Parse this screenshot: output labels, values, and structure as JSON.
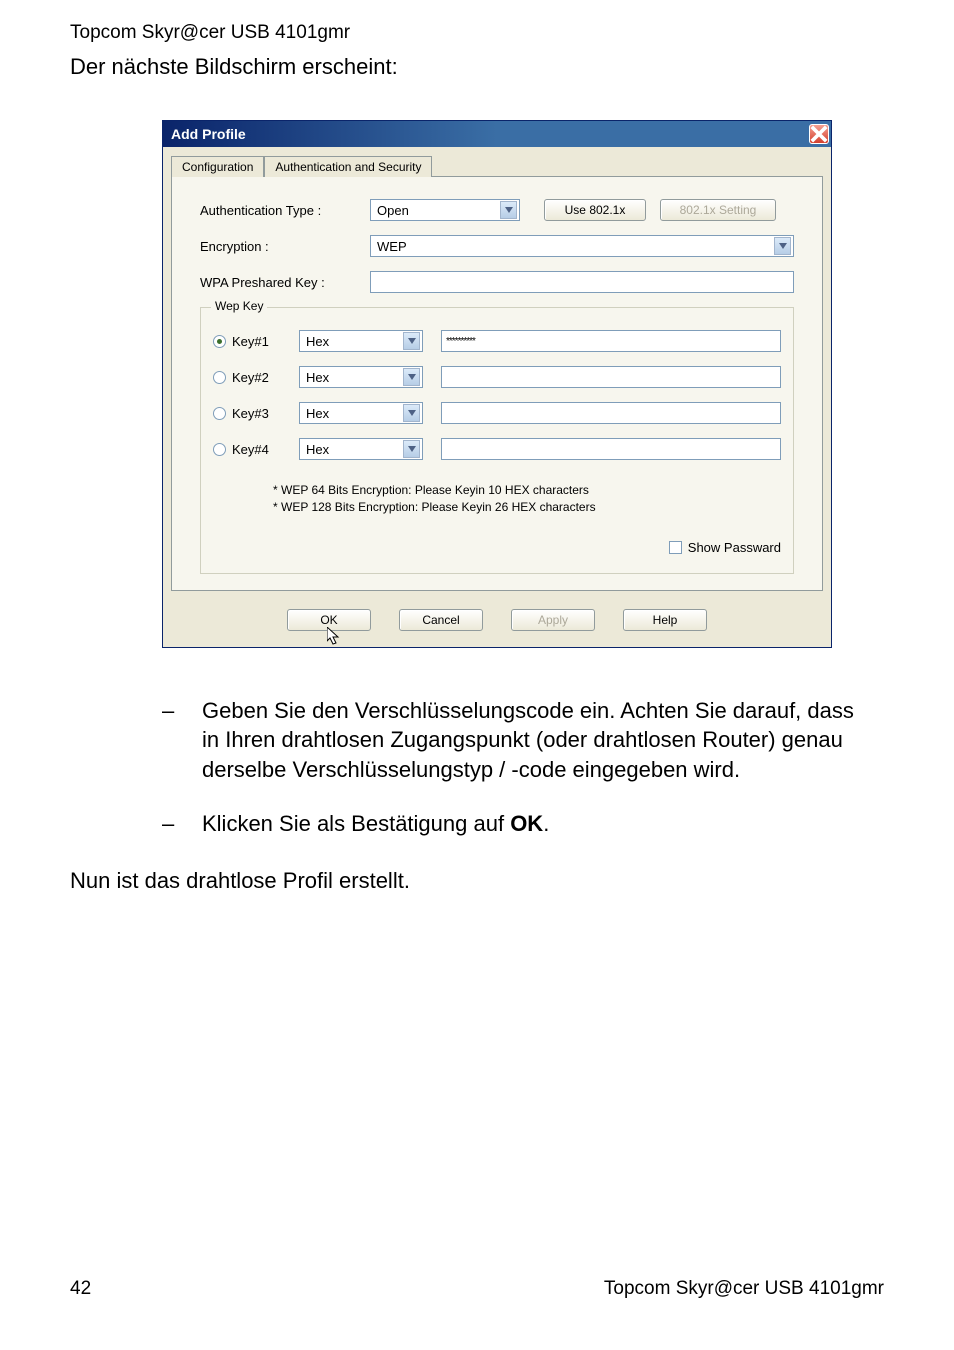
{
  "document": {
    "header": "Topcom Skyr@cer USB 4101gmr",
    "intro": "Der nächste Bildschirm erscheint:",
    "bullets": [
      "Geben Sie den Verschlüsselungscode ein. Achten Sie darauf, dass in Ihren drahtlosen Zugangspunkt (oder drahtlosen Router) genau derselbe Verschlüsselungstyp / -code eingegeben wird.",
      "Klicken Sie als Bestätigung auf "
    ],
    "bullet2_bold": "OK",
    "bullet2_after": ".",
    "final": "Nun ist das drahtlose Profil erstellt.",
    "page_number": "42",
    "footer_right": "Topcom Skyr@cer USB 4101gmr"
  },
  "dialog": {
    "title": "Add Profile",
    "tabs": {
      "configuration": "Configuration",
      "auth": "Authentication and Security"
    },
    "labels": {
      "auth_type": "Authentication Type :",
      "encryption": "Encryption :",
      "wpa_key": "WPA Preshared Key :",
      "wep_key": "Wep Key"
    },
    "auth_type_value": "Open",
    "use8021x": "Use 802.1x",
    "setting8021x": "802.1x Setting",
    "encryption_value": "WEP",
    "wpa_key_value": "",
    "keys": [
      {
        "label": "Key#1",
        "format": "Hex",
        "value": "**********",
        "checked": true
      },
      {
        "label": "Key#2",
        "format": "Hex",
        "value": "",
        "checked": false
      },
      {
        "label": "Key#3",
        "format": "Hex",
        "value": "",
        "checked": false
      },
      {
        "label": "Key#4",
        "format": "Hex",
        "value": "",
        "checked": false
      }
    ],
    "hints": [
      "* WEP 64 Bits Encryption:   Please Keyin 10 HEX characters",
      "* WEP 128 Bits Encryption:   Please Keyin 26 HEX characters"
    ],
    "show_passward": "Show Passward",
    "buttons": {
      "ok": "OK",
      "cancel": "Cancel",
      "apply": "Apply",
      "help": "Help"
    }
  }
}
